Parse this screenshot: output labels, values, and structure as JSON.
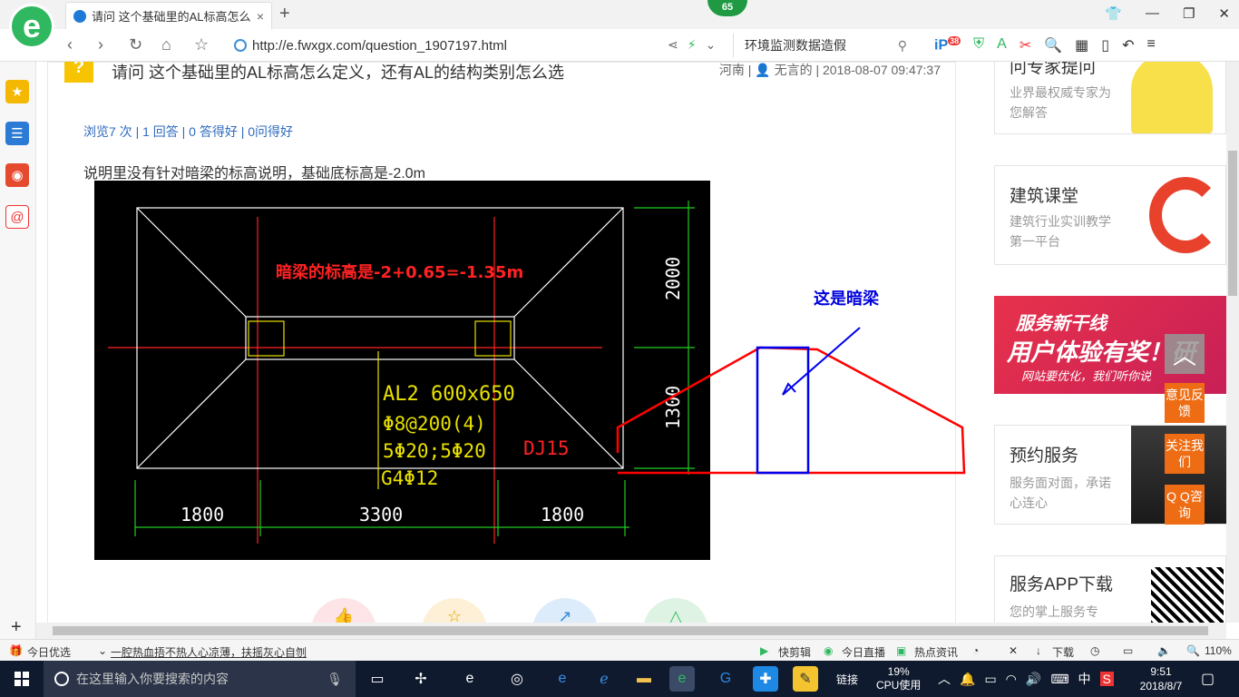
{
  "browser": {
    "tab_title": "请问 这个基础里的AL标高怎么定",
    "tab_close": "×",
    "new_tab": "+",
    "badge": "65",
    "url": "http://e.fwxgx.com/question_1907197.html",
    "search_text": "环境监测数据造假",
    "tool_badge": "38"
  },
  "question": {
    "title": "请问 这个基础里的AL标高怎么定义，还有AL的结构类别怎么选",
    "region": "河南",
    "author": "无言的",
    "datetime": "2018-08-07 09:47:37",
    "stats": "浏览7 次 | 1 回答 | 0 答得好 | 0问得好",
    "description": "说明里没有针对暗梁的标高说明，基础底标高是-2.0m"
  },
  "cad": {
    "elevation_note": "暗梁的标高是-2+0.65=-1.35m",
    "beam_label": "AL2 600x650",
    "stirrup": "Φ8@200(4)",
    "rebar": "5Φ20;5Φ20",
    "side_bar": "G4Φ12",
    "foundation_id": "DJ15",
    "dim_left": "1800",
    "dim_mid": "3300",
    "dim_right": "1800",
    "dim_v_top": "2000",
    "dim_v_bottom": "1300"
  },
  "annotation": {
    "label": "这是暗梁"
  },
  "sidebar": {
    "expert": {
      "title": "问专家提问",
      "sub": "业界最权威专家为您解答"
    },
    "course": {
      "title": "建筑课堂",
      "sub": "建筑行业实训教学第一平台"
    },
    "ad": {
      "line1": "服务新干线",
      "line2": "用户体验有奖！研",
      "line3": "网站要优化，我们听你说"
    },
    "booking": {
      "title": "预约服务",
      "sub": "服务面对面，承诺心连心"
    },
    "app": {
      "title": "服务APP下载",
      "sub": "您的掌上服务专"
    },
    "float_feedback": "意见反馈",
    "float_follow": "关注我们",
    "float_qq": "Q Q咨询"
  },
  "statusbar": {
    "today": "今日优选",
    "headline": "一腔热血捂不热人心凉薄，扶摇灰心自刎",
    "quickclip": "快剪辑",
    "live": "今日直播",
    "news": "热点资讯",
    "download": "下载",
    "zoom": "110%"
  },
  "taskbar": {
    "search_placeholder": "在这里输入你要搜索的内容",
    "link": "链接",
    "cpu_pct": "19%",
    "cpu_label": "CPU使用",
    "ime": "中",
    "time": "9:51",
    "date": "2018/8/7"
  },
  "colors": {
    "accent_blue": "#2f6bbf",
    "cad_red": "#ff2222",
    "cad_yellow": "#e8e000",
    "cad_green": "#22cc22",
    "brand_green": "#2fb85f",
    "float_orange": "#ee6c13"
  }
}
